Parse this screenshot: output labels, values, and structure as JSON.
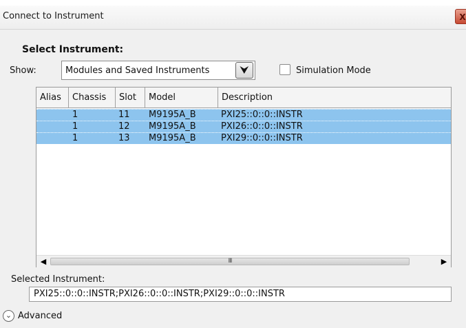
{
  "window": {
    "title": "Connect to Instrument",
    "close_label": "X"
  },
  "heading": "Select Instrument:",
  "filter": {
    "show_label": "Show:",
    "selected_option": "Modules and Saved Instruments",
    "dropdown_arrow": "⮟",
    "arrow_icon": "chevron-down-icon"
  },
  "simulation": {
    "label": "Simulation Mode",
    "checked": false
  },
  "table": {
    "columns": [
      "Alias",
      "Chassis",
      "Slot",
      "Model",
      "Description"
    ],
    "rows": [
      {
        "alias": "",
        "chassis": "1",
        "slot": "11",
        "model": "M9195A_B",
        "description": "PXI25::0::0::INSTR",
        "selected": true
      },
      {
        "alias": "",
        "chassis": "1",
        "slot": "12",
        "model": "M9195A_B",
        "description": "PXI26::0::0::INSTR",
        "selected": true
      },
      {
        "alias": "",
        "chassis": "1",
        "slot": "13",
        "model": "M9195A_B",
        "description": "PXI29::0::0::INSTR",
        "selected": true
      }
    ],
    "selection_color": "#8dc4ee",
    "scroll": {
      "left": "◀",
      "right": "▶",
      "grip": "III"
    }
  },
  "selected_instrument": {
    "label": "Selected Instrument:",
    "value": "PXI25::0::0::INSTR;PXI26::0::0::INSTR;PXI29::0::0::INSTR"
  },
  "advanced": {
    "label": "Advanced",
    "icon": "⌄",
    "icon_name": "expand-chevron-icon"
  }
}
